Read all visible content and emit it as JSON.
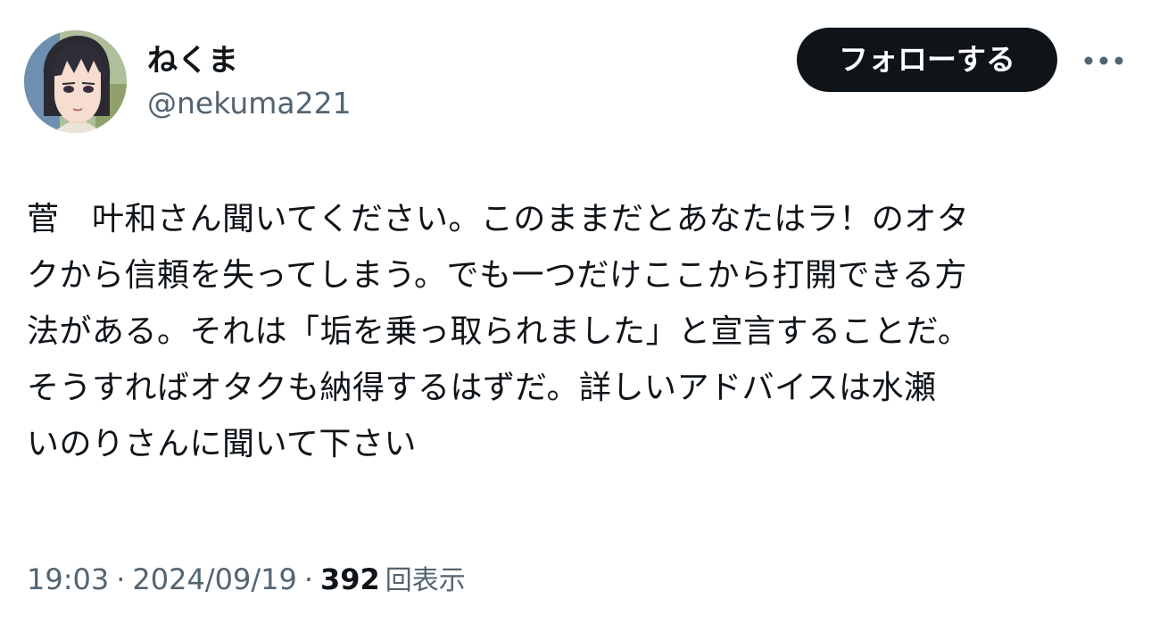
{
  "author": {
    "display_name": "ねくま",
    "handle": "@nekuma221",
    "avatar_icon": "anime-character-avatar"
  },
  "actions": {
    "follow_label": "フォローする",
    "more_icon": "more-horizontal-icon"
  },
  "tweet": {
    "lines": [
      "菅　叶和さん聞いてください。このままだとあなたはラ！のオタ",
      "クから信頼を失ってしまう。でも一つだけここから打開できる方",
      "法がある。それは「垢を乗っ取られました」と宣言することだ。",
      "そうすればオタクも納得するはずだ。詳しいアドバイスは水瀬",
      "いのりさんに聞いて下さい"
    ]
  },
  "meta": {
    "time": "19:03",
    "separator": "·",
    "date": "2024/09/19",
    "views_count": "392",
    "views_label": "回表示"
  },
  "colors": {
    "text_primary": "#0f1419",
    "text_secondary": "#536471",
    "follow_button_bg": "#0f1419",
    "follow_button_text": "#ffffff",
    "more_dots": "#536471"
  }
}
